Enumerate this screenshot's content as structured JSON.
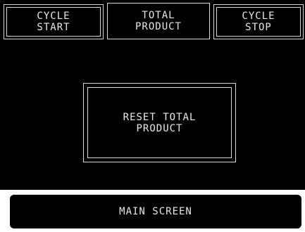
{
  "tabs": {
    "cycle_start": {
      "line1": "CYCLE",
      "line2": "START"
    },
    "total_product": {
      "line1": "TOTAL",
      "line2": "PRODUCT"
    },
    "cycle_stop": {
      "line1": "CYCLE",
      "line2": "STOP"
    }
  },
  "reset_button": {
    "line1": "RESET TOTAL",
    "line2": "PRODUCT"
  },
  "main_screen_button": "MAIN SCREEN",
  "colors": {
    "background": "#000000",
    "foreground": "#e8e8e8",
    "bottom_bar": "#ffffff"
  }
}
